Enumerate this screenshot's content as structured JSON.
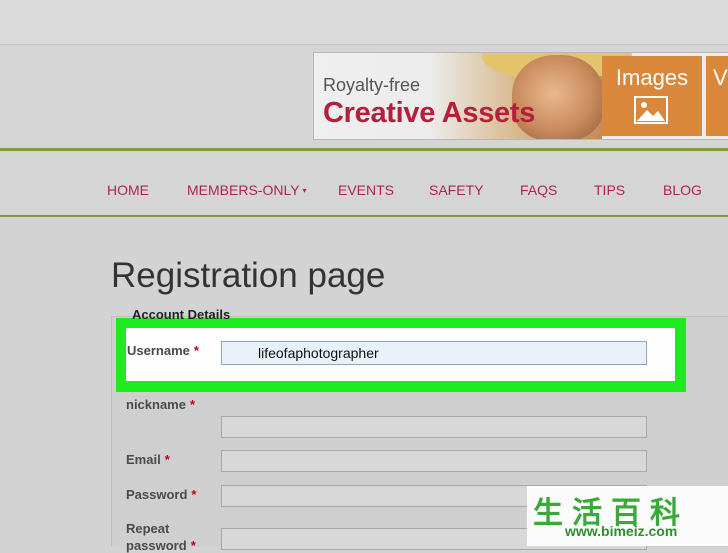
{
  "ad": {
    "line1": "Royalty-free",
    "line2": "Creative Assets",
    "tile1": "Images",
    "tile2": "V"
  },
  "nav": {
    "items": [
      "HOME",
      "MEMBERS-ONLY",
      "EVENTS",
      "SAFETY",
      "FAQS",
      "TIPS",
      "BLOG"
    ],
    "caret": "▾"
  },
  "page": {
    "title": "Registration page"
  },
  "form": {
    "legend": "Account Details",
    "required_mark": "*",
    "fields": [
      {
        "label": "Username",
        "value": "lifeofaphotographer"
      },
      {
        "label": "nickname",
        "value": ""
      },
      {
        "label": "Email",
        "value": ""
      },
      {
        "label": "Password",
        "value": ""
      },
      {
        "label": "Repeat",
        "label2": "password"
      }
    ]
  },
  "watermark": {
    "cjk": "生活百科",
    "url": "www.bimeiz.com"
  },
  "colors": {
    "nav_text": "#b0244a",
    "nav_rule": "#7f9b3a",
    "highlight": "#1eea1e",
    "ad_accent": "#d9873b",
    "required": "#c0001a"
  }
}
